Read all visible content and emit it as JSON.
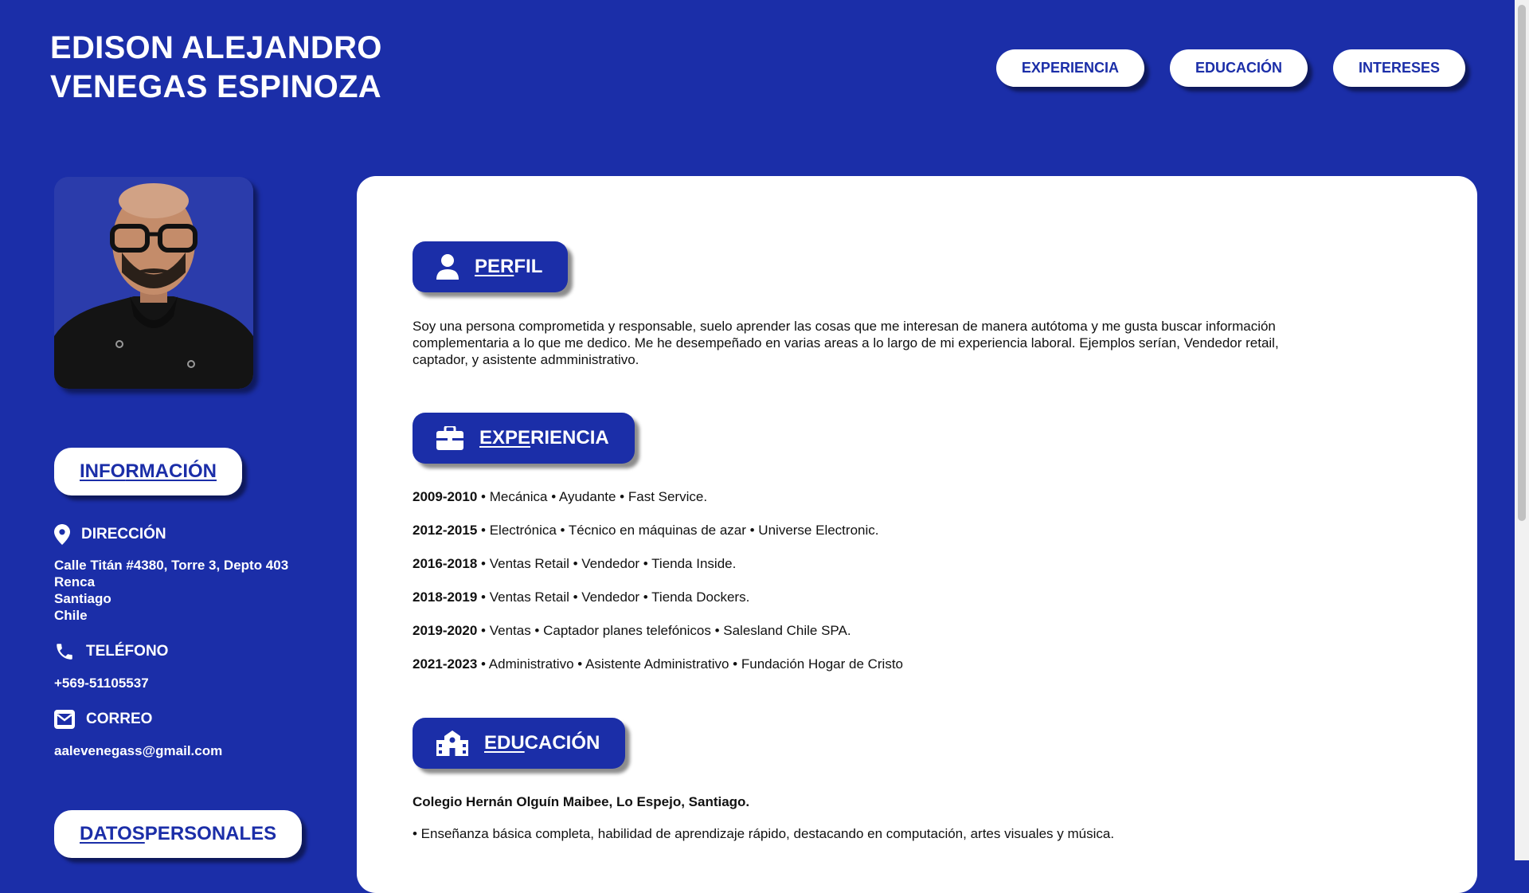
{
  "header": {
    "name_line1": "EDISON ALEJANDRO",
    "name_line2": "VENEGAS ESPINOZA"
  },
  "nav": {
    "items": [
      {
        "label": "EXPERIENCIA"
      },
      {
        "label": "EDUCACIÓN"
      },
      {
        "label": "INTERESES"
      }
    ]
  },
  "sidebar": {
    "photo_icon": "profile-photo",
    "info_title_a": "INFO",
    "info_title_b": "RMACIÓN",
    "direccion_label": "DIRECCIÓN",
    "direccion_icon": "map-pin-icon",
    "address_lines": [
      "Calle Titán #4380, Torre 3, Depto 403",
      "Renca",
      "Santiago",
      "Chile"
    ],
    "telefono_label": "TELÉFONO",
    "telefono_icon": "phone-icon",
    "telefono": "+569-51105537",
    "correo_label": "CORREO",
    "correo_icon": "envelope-icon",
    "correo": "aalevenegass@gmail.com",
    "datos_title_a": "DATOS",
    "datos_title_b": " PERSONALES"
  },
  "main": {
    "perfil": {
      "title_a": "PER",
      "title_b": "FIL",
      "icon": "user-icon",
      "text": "Soy una persona comprometida y responsable, suelo aprender las cosas que me interesan de manera autótoma y me gusta buscar información complementaria a lo que me dedico. Me he desempeñado en varias areas a lo largo de mi experiencia laboral. Ejemplos serían, Vendedor retail, captador, y asistente admministrativo."
    },
    "experiencia": {
      "title_a": "EXPE",
      "title_b": "RIENCIA",
      "icon": "briefcase-icon",
      "items": [
        {
          "years": "2009-2010",
          "rest": " • Mecánica • Ayudante • Fast Service."
        },
        {
          "years": "2012-2015",
          "rest": " • Electrónica • Técnico en máquinas de azar • Universe Electronic."
        },
        {
          "years": "2016-2018",
          "rest": " • Ventas Retail • Vendedor • Tienda Inside."
        },
        {
          "years": "2018-2019",
          "rest": " • Ventas Retail • Vendedor • Tienda Dockers."
        },
        {
          "years": "2019-2020",
          "rest": " • Ventas • Captador planes telefónicos • Salesland Chile SPA."
        },
        {
          "years": "2021-2023",
          "rest": " • Administrativo • Asistente Administrativo • Fundación Hogar de Cristo"
        }
      ]
    },
    "educacion": {
      "title_a": "EDU",
      "title_b": "CACIÓN",
      "icon": "school-icon",
      "school": "Colegio Hernán Olguín Maibee, Lo Espejo, Santiago.",
      "desc": "• Enseñanza básica completa, habilidad de aprendizaje rápido, destacando en computación, artes visuales y música."
    }
  },
  "colors": {
    "primary": "#1b2ea8",
    "card": "#ffffff"
  }
}
